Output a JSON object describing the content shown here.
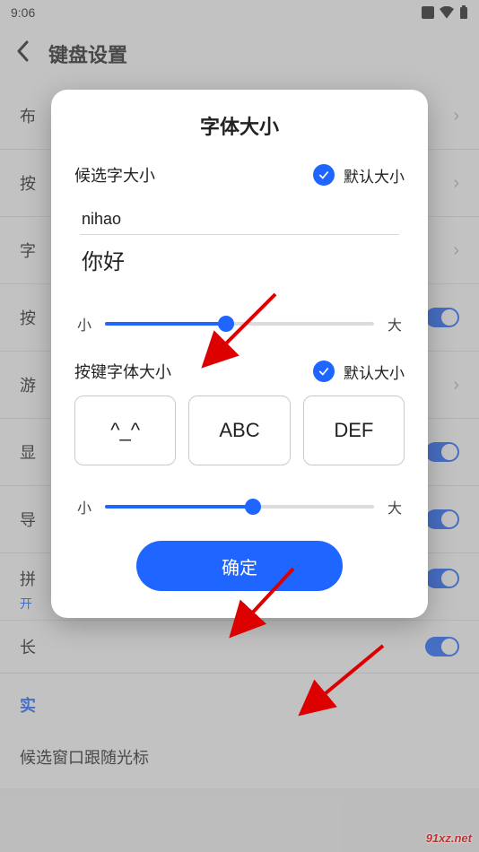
{
  "status": {
    "time": "9:06"
  },
  "header": {
    "title": "键盘设置"
  },
  "settings": {
    "items": [
      {
        "label": "布"
      },
      {
        "label": "按"
      },
      {
        "label": "字"
      },
      {
        "label": "按"
      },
      {
        "label": "游"
      },
      {
        "label": "显"
      },
      {
        "label": "导"
      },
      {
        "label": "拼"
      },
      {
        "label": "长"
      }
    ],
    "sub_label": "开",
    "link_label": "实",
    "footer_label": "候选窗口跟随光标"
  },
  "modal": {
    "title": "字体大小",
    "candidate": {
      "label": "候选字大小",
      "default_label": "默认大小",
      "checked": true,
      "preview_pinyin": "nihao",
      "preview_hanzi": "你好",
      "min_label": "小",
      "max_label": "大",
      "value_percent": 45
    },
    "keyfont": {
      "label": "按键字体大小",
      "default_label": "默认大小",
      "checked": true,
      "keys": [
        "^_^",
        "ABC",
        "DEF"
      ],
      "min_label": "小",
      "max_label": "大",
      "value_percent": 55
    },
    "confirm_label": "确定"
  },
  "watermark": "91xz.net"
}
